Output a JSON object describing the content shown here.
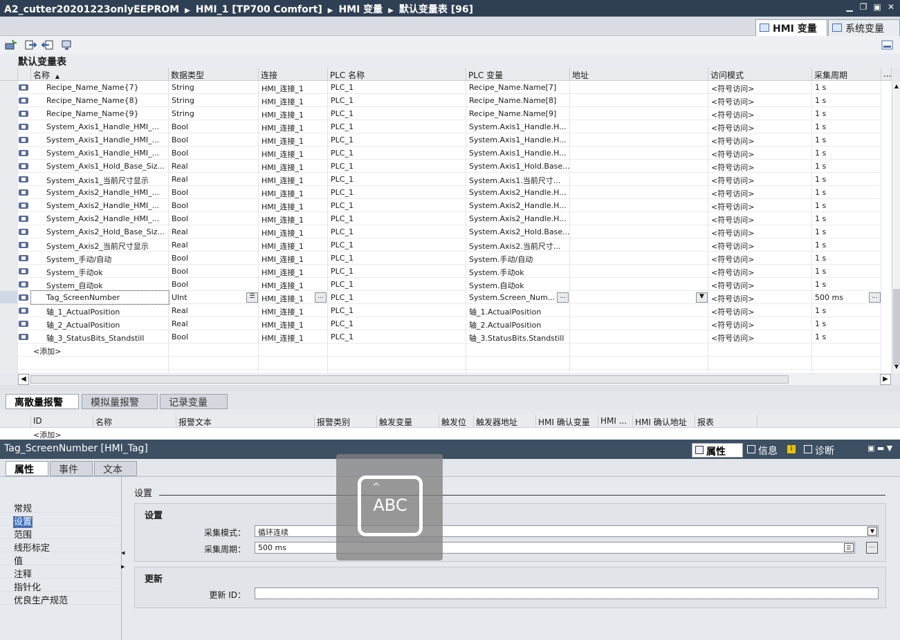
{
  "breadcrumb": {
    "items": [
      "A2_cutter20201223onlyEEPROM",
      "HMI_1 [TP700 Comfort]",
      "HMI 变量",
      "默认变量表 [96]"
    ]
  },
  "view_tabs": {
    "hmi_tags": "HMI 变量",
    "system_tags": "系统变量"
  },
  "table": {
    "title": "默认变量表",
    "columns": [
      "名称",
      "数据类型",
      "连接",
      "PLC 名称",
      "PLC 变量",
      "地址",
      "访问模式",
      "采集周期",
      "..."
    ],
    "rows": [
      [
        "Recipe_Name_Name{7}",
        "String",
        "HMI_连接_1",
        "PLC_1",
        "Recipe_Name.Name[7]",
        "",
        "<符号访问>",
        "1 s"
      ],
      [
        "Recipe_Name_Name{8}",
        "String",
        "HMI_连接_1",
        "PLC_1",
        "Recipe_Name.Name[8]",
        "",
        "<符号访问>",
        "1 s"
      ],
      [
        "Recipe_Name_Name{9}",
        "String",
        "HMI_连接_1",
        "PLC_1",
        "Recipe_Name.Name[9]",
        "",
        "<符号访问>",
        "1 s"
      ],
      [
        "System_Axis1_Handle_HMI_...",
        "Bool",
        "HMI_连接_1",
        "PLC_1",
        "System.Axis1_Handle.H...",
        "",
        "<符号访问>",
        "1 s"
      ],
      [
        "System_Axis1_Handle_HMI_...",
        "Bool",
        "HMI_连接_1",
        "PLC_1",
        "System.Axis1_Handle.H...",
        "",
        "<符号访问>",
        "1 s"
      ],
      [
        "System_Axis1_Handle_HMI_...",
        "Bool",
        "HMI_连接_1",
        "PLC_1",
        "System.Axis1_Handle.H...",
        "",
        "<符号访问>",
        "1 s"
      ],
      [
        "System_Axis1_Hold_Base_Siz...",
        "Real",
        "HMI_连接_1",
        "PLC_1",
        "System.Axis1_Hold.Base...",
        "",
        "<符号访问>",
        "1 s"
      ],
      [
        "System_Axis1_当前尺寸显示",
        "Real",
        "HMI_连接_1",
        "PLC_1",
        "System.Axis1.当前尺寸...",
        "",
        "<符号访问>",
        "1 s"
      ],
      [
        "System_Axis2_Handle_HMI_...",
        "Bool",
        "HMI_连接_1",
        "PLC_1",
        "System.Axis2_Handle.H...",
        "",
        "<符号访问>",
        "1 s"
      ],
      [
        "System_Axis2_Handle_HMI_...",
        "Bool",
        "HMI_连接_1",
        "PLC_1",
        "System.Axis2_Handle.H...",
        "",
        "<符号访问>",
        "1 s"
      ],
      [
        "System_Axis2_Handle_HMI_...",
        "Bool",
        "HMI_连接_1",
        "PLC_1",
        "System.Axis2_Handle.H...",
        "",
        "<符号访问>",
        "1 s"
      ],
      [
        "System_Axis2_Hold_Base_Siz...",
        "Real",
        "HMI_连接_1",
        "PLC_1",
        "System.Axis2_Hold.Base...",
        "",
        "<符号访问>",
        "1 s"
      ],
      [
        "System_Axis2_当前尺寸显示",
        "Real",
        "HMI_连接_1",
        "PLC_1",
        "System.Axis2.当前尺寸...",
        "",
        "<符号访问>",
        "1 s"
      ],
      [
        "System_手动/自动",
        "Bool",
        "HMI_连接_1",
        "PLC_1",
        "System.手动/自动",
        "",
        "<符号访问>",
        "1 s"
      ],
      [
        "System_手动ok",
        "Bool",
        "HMI_连接_1",
        "PLC_1",
        "System.手动ok",
        "",
        "<符号访问>",
        "1 s"
      ],
      [
        "System_自动ok",
        "Bool",
        "HMI_连接_1",
        "PLC_1",
        "System.自动ok",
        "",
        "<符号访问>",
        "1 s"
      ],
      [
        "Tag_ScreenNumber",
        "UInt",
        "HMI_连接_1",
        "PLC_1",
        "System.Screen_Num...",
        "",
        "<符号访问>",
        "500 ms"
      ],
      [
        "轴_1_ActualPosition",
        "Real",
        "HMI_连接_1",
        "PLC_1",
        "轴_1.ActualPosition",
        "",
        "<符号访问>",
        "1 s"
      ],
      [
        "轴_2_ActualPosition",
        "Real",
        "HMI_连接_1",
        "PLC_1",
        "轴_2.ActualPosition",
        "",
        "<符号访问>",
        "1 s"
      ],
      [
        "轴_3_StatusBits_Standstill",
        "Bool",
        "HMI_连接_1",
        "PLC_1",
        "轴_3.StatusBits.Standstill",
        "",
        "<符号访问>",
        "1 s"
      ]
    ],
    "add_row": "<添加>",
    "selected_row": 16
  },
  "alarm_tabs": [
    "离散量报警",
    "模拟量报警",
    "记录变量"
  ],
  "alarm_table": {
    "columns": [
      "ID",
      "名称",
      "报警文本",
      "报警类别",
      "触发变量",
      "触发位",
      "触发器地址",
      "HMI 确认变量",
      "HMI ...",
      "HMI 确认地址",
      "报表"
    ],
    "add_row": "<添加>"
  },
  "inspector": {
    "title": "Tag_ScreenNumber [HMI_Tag]",
    "right_tabs": [
      "属性",
      "信息",
      "诊断"
    ],
    "tabs": [
      "属性",
      "事件",
      "文本"
    ],
    "nav": [
      "常规",
      "设置",
      "范围",
      "线形标定",
      "值",
      "注释",
      "指针化",
      "优良生产规范"
    ],
    "active_nav": 1,
    "section_title": "设置",
    "settings_group": "设置",
    "acq_mode_label": "采集模式：",
    "acq_mode_value": "循环连续",
    "acq_cycle_label": "采集周期：",
    "acq_cycle_value": "500 ms",
    "update_group": "更新",
    "update_id_label": "更新 ID：",
    "update_id_value": ""
  },
  "overlay": {
    "text": "ABC"
  }
}
